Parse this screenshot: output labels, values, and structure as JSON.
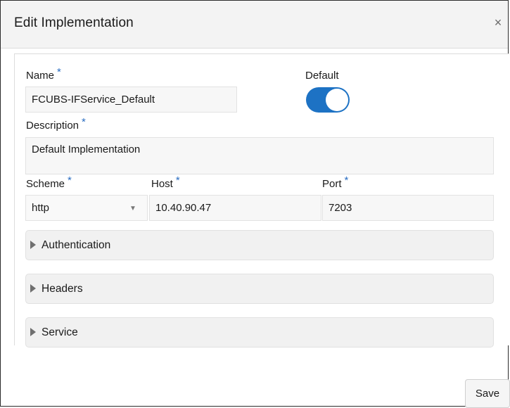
{
  "dialog": {
    "title": "Edit Implementation",
    "close_glyph": "×"
  },
  "form": {
    "name": {
      "label": "Name",
      "required_mark": "*",
      "value": "FCUBS-IFService_Default"
    },
    "default": {
      "label": "Default",
      "enabled": true
    },
    "description": {
      "label": "Description",
      "required_mark": "*",
      "value": "Default Implementation"
    },
    "scheme": {
      "label": "Scheme",
      "required_mark": "*",
      "value": "http"
    },
    "host": {
      "label": "Host",
      "required_mark": "*",
      "value": "10.40.90.47"
    },
    "port": {
      "label": "Port",
      "required_mark": "*",
      "value": "7203"
    }
  },
  "sections": [
    {
      "label": "Authentication"
    },
    {
      "label": "Headers"
    },
    {
      "label": "Service"
    }
  ],
  "footer": {
    "save_label": "Save"
  },
  "colors": {
    "accent": "#1d72c4",
    "required": "#2b6ec2"
  }
}
